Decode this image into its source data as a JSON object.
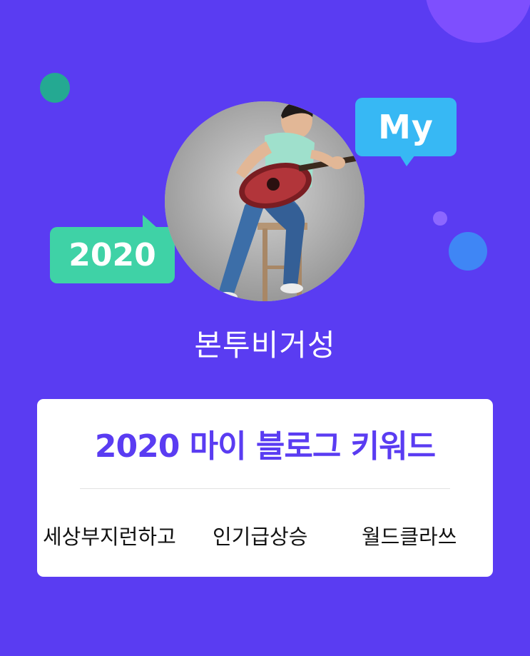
{
  "header": {
    "bubble_my": "My",
    "bubble_year": "2020"
  },
  "profile": {
    "blog_name": "본투비거성"
  },
  "card": {
    "title": "2020 마이 블로그 키워드",
    "keywords": [
      "세상부지런하고",
      "인기급상승",
      "월드클라쓰"
    ]
  },
  "colors": {
    "background": "#5a3cf2",
    "accent_purple": "#5a3cf2",
    "bubble_blue": "#37b8f4",
    "bubble_green": "#3fd2a6",
    "card": "#ffffff"
  }
}
